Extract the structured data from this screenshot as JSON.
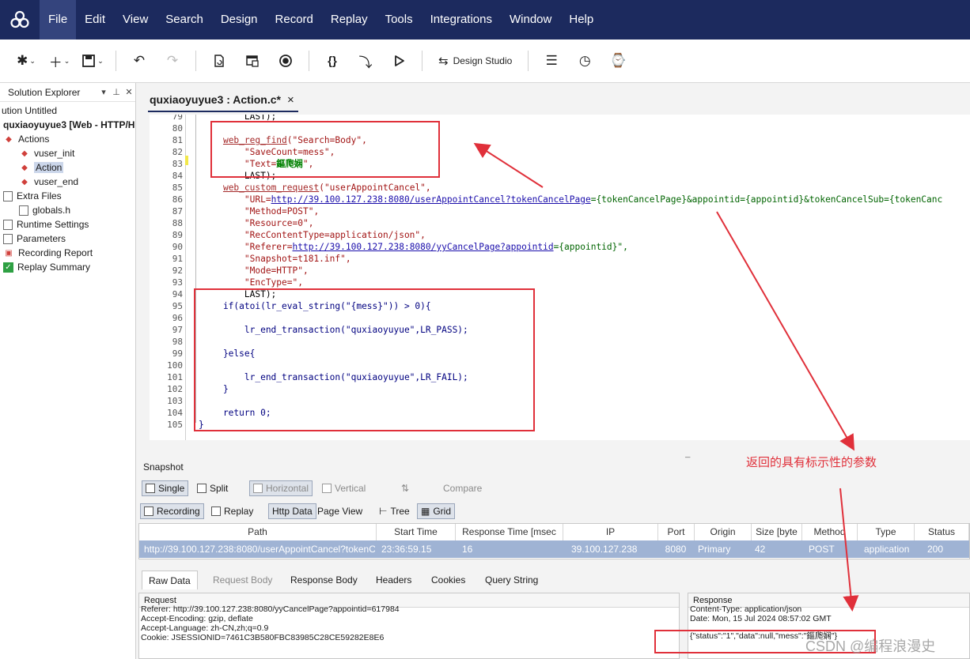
{
  "menu": {
    "items": [
      "File",
      "Edit",
      "View",
      "Search",
      "Design",
      "Record",
      "Replay",
      "Tools",
      "Integrations",
      "Window",
      "Help"
    ]
  },
  "toolbar": {
    "design_studio_label": "Design Studio"
  },
  "sidebar": {
    "title": "Solution Explorer",
    "solution_label": "ution Untitled",
    "script_label": "quxiaoyuyue3 [Web - HTTP/H",
    "actions_label": "Actions",
    "items": [
      "vuser_init",
      "Action",
      "vuser_end"
    ],
    "extra_files_label": "Extra Files",
    "globals_label": "globals.h",
    "runtime_settings_label": "Runtime Settings",
    "parameters_label": "Parameters",
    "recording_report_label": "Recording Report",
    "replay_summary_label": "Replay Summary"
  },
  "editor": {
    "tab_label": "quxiaoyuyue3 : Action.c*",
    "tab_close": "×",
    "line_numbers": [
      "79",
      "80",
      "81",
      "82",
      "83",
      "84",
      "85",
      "86",
      "87",
      "88",
      "89",
      "90",
      "91",
      "92",
      "93",
      "94",
      "95",
      "96",
      "97",
      "98",
      "99",
      "100",
      "101",
      "102",
      "103",
      "104",
      "105"
    ],
    "lines": {
      "l79": "        LAST);",
      "l81_fn": "web_reg_find",
      "l81_rest": "(\"Search=Body\",",
      "l82": "        \"SaveCount=mess\",",
      "l83_a": "        \"Text=",
      "l83_b": "鏂爮娴",
      "l83_c": "\",",
      "l84": "        LAST);",
      "l85_fn": "web_custom_request",
      "l85_rest": "(\"userAppointCancel\",",
      "l86_a": "        \"URL=",
      "l86_url": "http://39.100.127.238:8080/userAppointCancel?tokenCancelPage",
      "l86_b": "={tokenCancelPage}&appointid={appointid}&tokenCancelSub={tokenCanc",
      "l87": "        \"Method=POST\",",
      "l88": "        \"Resource=0\",",
      "l89": "        \"RecContentType=application/json\",",
      "l90_a": "        \"Referer=",
      "l90_url": "http://39.100.127.238:8080/yyCancelPage?appointid",
      "l90_b": "={appointid}\",",
      "l91": "        \"Snapshot=t181.inf\",",
      "l92": "        \"Mode=HTTP\",",
      "l93": "        \"EncType=\",",
      "l94": "        LAST);",
      "l95": "    if(atoi(lr_eval_string(\"{mess}\")) > 0){",
      "l97": "        lr_end_transaction(\"quxiaoyuyue\",LR_PASS);",
      "l99": "    }else{",
      "l101": "        lr_end_transaction(\"quxiaoyuyue\",LR_FAIL);",
      "l102": "    }",
      "l104": "    return 0;",
      "l105": "}"
    }
  },
  "snapshot": {
    "title": "Snapshot",
    "buttons": {
      "single": "Single",
      "split": "Split",
      "horizontal": "Horizontal",
      "vertical": "Vertical",
      "compare": "Compare",
      "recording": "Recording",
      "replay": "Replay",
      "http_data": "Http Data",
      "page_view": "Page View",
      "tree": "Tree",
      "grid": "Grid"
    },
    "grid": {
      "headers": [
        "Path",
        "Start Time",
        "Response Time [msec",
        "IP",
        "Port",
        "Origin",
        "Size [byte",
        "Method",
        "Type",
        "Status"
      ],
      "row": [
        "http://39.100.127.238:8080/userAppointCancel?tokenC",
        "23:36:59.15",
        "16",
        "39.100.127.238",
        "8080",
        "Primary",
        "42",
        "POST",
        "application",
        "200"
      ]
    },
    "tabs": [
      "Raw Data",
      "Request Body",
      "Response Body",
      "Headers",
      "Cookies",
      "Query String"
    ],
    "request": {
      "title": "Request",
      "lines": [
        "Referer: http://39.100.127.238:8080/yyCancelPage?appointid=617984",
        "Accept-Encoding: gzip, deflate",
        "Accept-Language: zh-CN,zh;q=0.9",
        "Cookie: JSESSIONID=7461C3B580FBC83985C28CE59282E8E6"
      ]
    },
    "response": {
      "title": "Response",
      "lines": [
        "Content-Type: application/json",
        "Date: Mon, 15 Jul 2024 08:57:02 GMT",
        "{\"status\":\"1\",\"data\":null,\"mess\":\"鏂爮娴\"}"
      ]
    }
  },
  "annotation": {
    "text": "返回的具有标示性的参数",
    "color": "#e0303a"
  },
  "watermark": "CSDN @编程浪漫史",
  "colors": {
    "menubar": "#1c2a5e",
    "selection": "#9fb3d4",
    "annotation_red": "#e0303a"
  }
}
